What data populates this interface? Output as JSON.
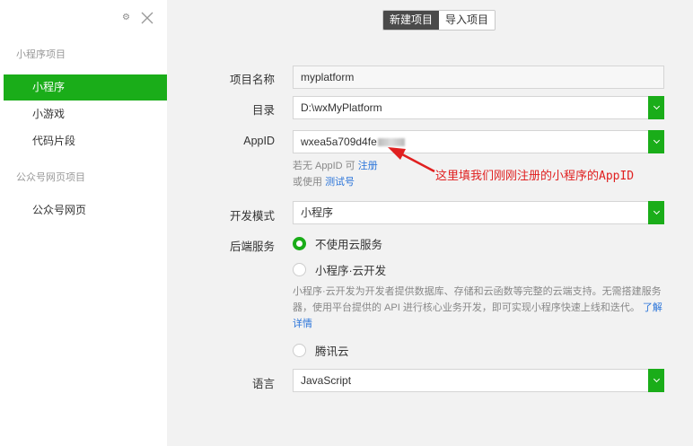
{
  "sidebar": {
    "group_miniprogram": "小程序项目",
    "items_mp": [
      {
        "label": "小程序"
      },
      {
        "label": "小游戏"
      },
      {
        "label": "代码片段"
      }
    ],
    "group_official": "公众号网页项目",
    "items_official": [
      {
        "label": "公众号网页"
      }
    ]
  },
  "tabs": [
    {
      "label": "新建项目"
    },
    {
      "label": "导入项目"
    }
  ],
  "form": {
    "name_label": "项目名称",
    "name_value": "myplatform",
    "dir_label": "目录",
    "dir_value": "D:\\wxMyPlatform",
    "appid_label": "AppID",
    "appid_value": "wxea5a709d4fe",
    "appid_hint_prefix": "若无 AppID 可",
    "appid_hint_register": "注册",
    "appid_hint_or": "或使用",
    "appid_hint_test": "测试号",
    "mode_label": "开发模式",
    "mode_value": "小程序",
    "backend_label": "后端服务",
    "opt_no_cloud": "不使用云服务",
    "opt_cloud": "小程序·云开发",
    "cloud_desc": "小程序·云开发为开发者提供数据库、存储和云函数等完整的云端支持。无需搭建服务器，使用平台提供的 API 进行核心业务开发，即可实现小程序快速上线和迭代。",
    "cloud_more": "了解详情",
    "opt_tencent": "腾讯云",
    "lang_label": "语言",
    "lang_value": "JavaScript"
  },
  "annotation": "这里填我们刚刚注册的小程序的AppID",
  "colors": {
    "accent": "#1aad19",
    "link": "#2a74d9",
    "annotation": "#e02020"
  }
}
